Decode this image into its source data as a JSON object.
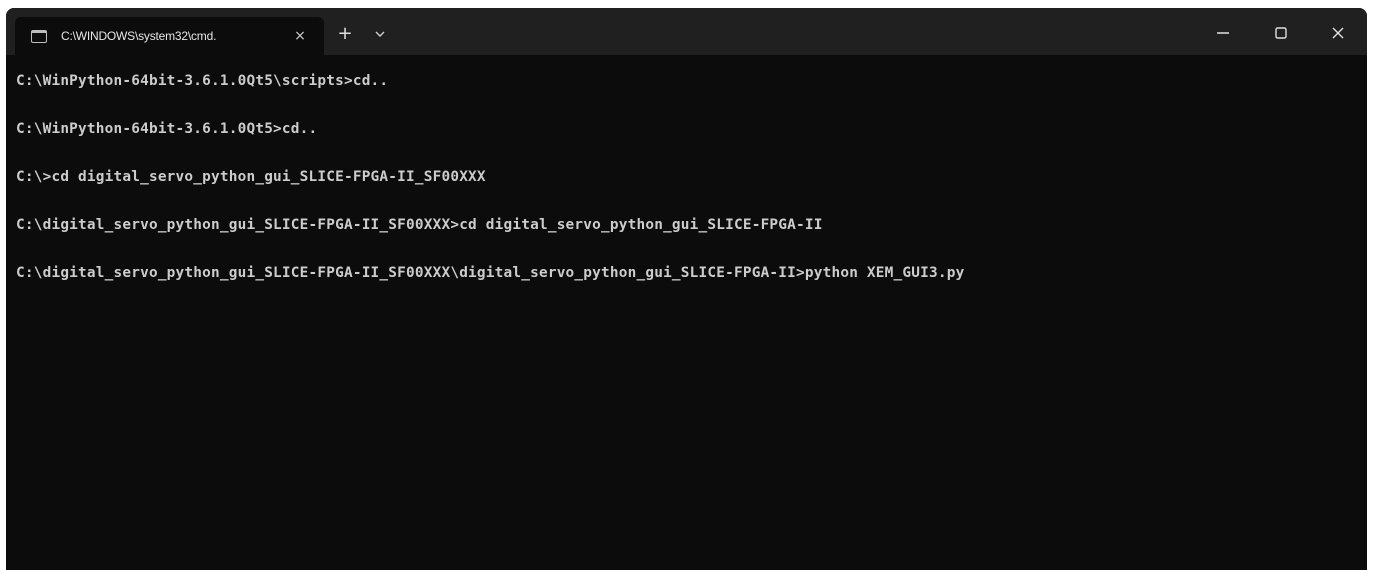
{
  "window": {
    "tab_title": "C:\\WINDOWS\\system32\\cmd.",
    "icons": {
      "tab": "terminal-icon",
      "close_tab": "close-icon",
      "new_tab": "plus-icon",
      "dropdown": "chevron-down-icon",
      "minimize": "minimize-icon",
      "maximize": "maximize-icon",
      "close": "close-icon"
    },
    "tab_close_glyph": "×",
    "new_tab_glyph": "+"
  },
  "console": {
    "lines": [
      "C:\\WinPython-64bit-3.6.1.0Qt5\\scripts>cd..",
      "C:\\WinPython-64bit-3.6.1.0Qt5>cd..",
      "C:\\>cd digital_servo_python_gui_SLICE-FPGA-II_SF00XXX",
      "C:\\digital_servo_python_gui_SLICE-FPGA-II_SF00XXX>cd digital_servo_python_gui_SLICE-FPGA-II",
      "C:\\digital_servo_python_gui_SLICE-FPGA-II_SF00XXX\\digital_servo_python_gui_SLICE-FPGA-II>python XEM_GUI3.py"
    ]
  },
  "colors": {
    "console_bg": "#0c0c0c",
    "titlebar_bg": "#202020",
    "text": "#cccccc"
  }
}
